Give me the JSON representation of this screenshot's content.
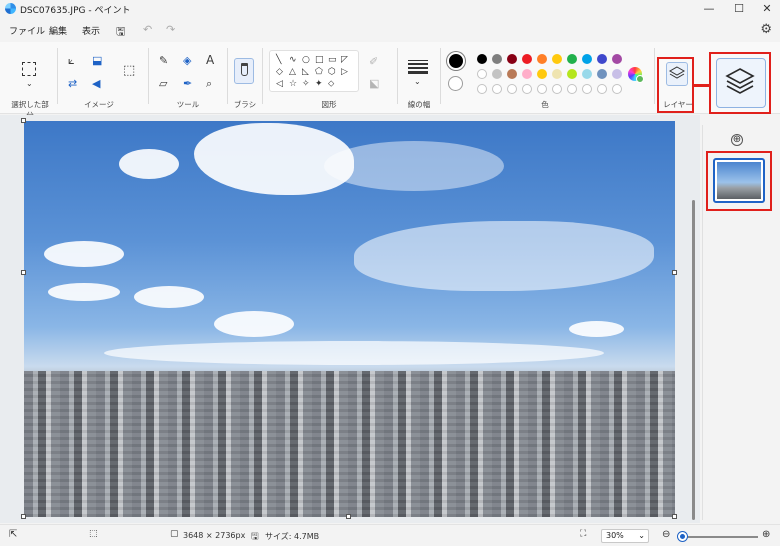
{
  "window": {
    "title": "DSC07635.JPG - ペイント",
    "controls": {
      "minimize": "—",
      "maximize": "☐",
      "close": "✕"
    }
  },
  "menu": {
    "items": [
      "ファイル",
      "編集",
      "表示"
    ],
    "save_icon": "save-icon",
    "undo_icon": "undo-icon",
    "redo_icon": "redo-icon",
    "settings_icon": "gear-icon"
  },
  "ribbon": {
    "groups": {
      "selection": "選択した部分",
      "image": "イメージ",
      "tools": "ツール",
      "brush": "ブラシ",
      "shapes": "図形",
      "line_width": "線の幅",
      "colors": "色",
      "layers": "レイヤー"
    },
    "tools_text_glyph": "A",
    "shape_glyphs": [
      "╲",
      "∿",
      "○",
      "□",
      "▭",
      "◸",
      "◇",
      "△",
      "◺",
      "⬠",
      "⬡",
      "▷",
      "◁",
      "☆",
      "✧",
      "✦",
      "⬦"
    ],
    "palette_row1": [
      "#000000",
      "#7f7f7f",
      "#880015",
      "#ed1c24",
      "#ff7f27",
      "#ffc90e",
      "#22b14c",
      "#00a2e8",
      "#3f48cc",
      "#a349a4"
    ],
    "palette_row2": [
      "#ffffff",
      "#c3c3c3",
      "#b97a57",
      "#ffaec9",
      "#ffc90e",
      "#efe4b0",
      "#b5e61d",
      "#99d9ea",
      "#7092be",
      "#c8bfe7"
    ]
  },
  "canvas": {
    "image_description_icon": "photo-canvas"
  },
  "layers_panel": {
    "add_icon": "⊕"
  },
  "status": {
    "dimensions": "3648 × 2736px",
    "size": "サイズ: 4.7MB",
    "zoom": "30%",
    "zoom_level": 0.3
  },
  "colors": {
    "accent": "#1f63c6",
    "highlight": "#e0201b",
    "primary_color": "#000000",
    "secondary_color": "#ffffff"
  }
}
